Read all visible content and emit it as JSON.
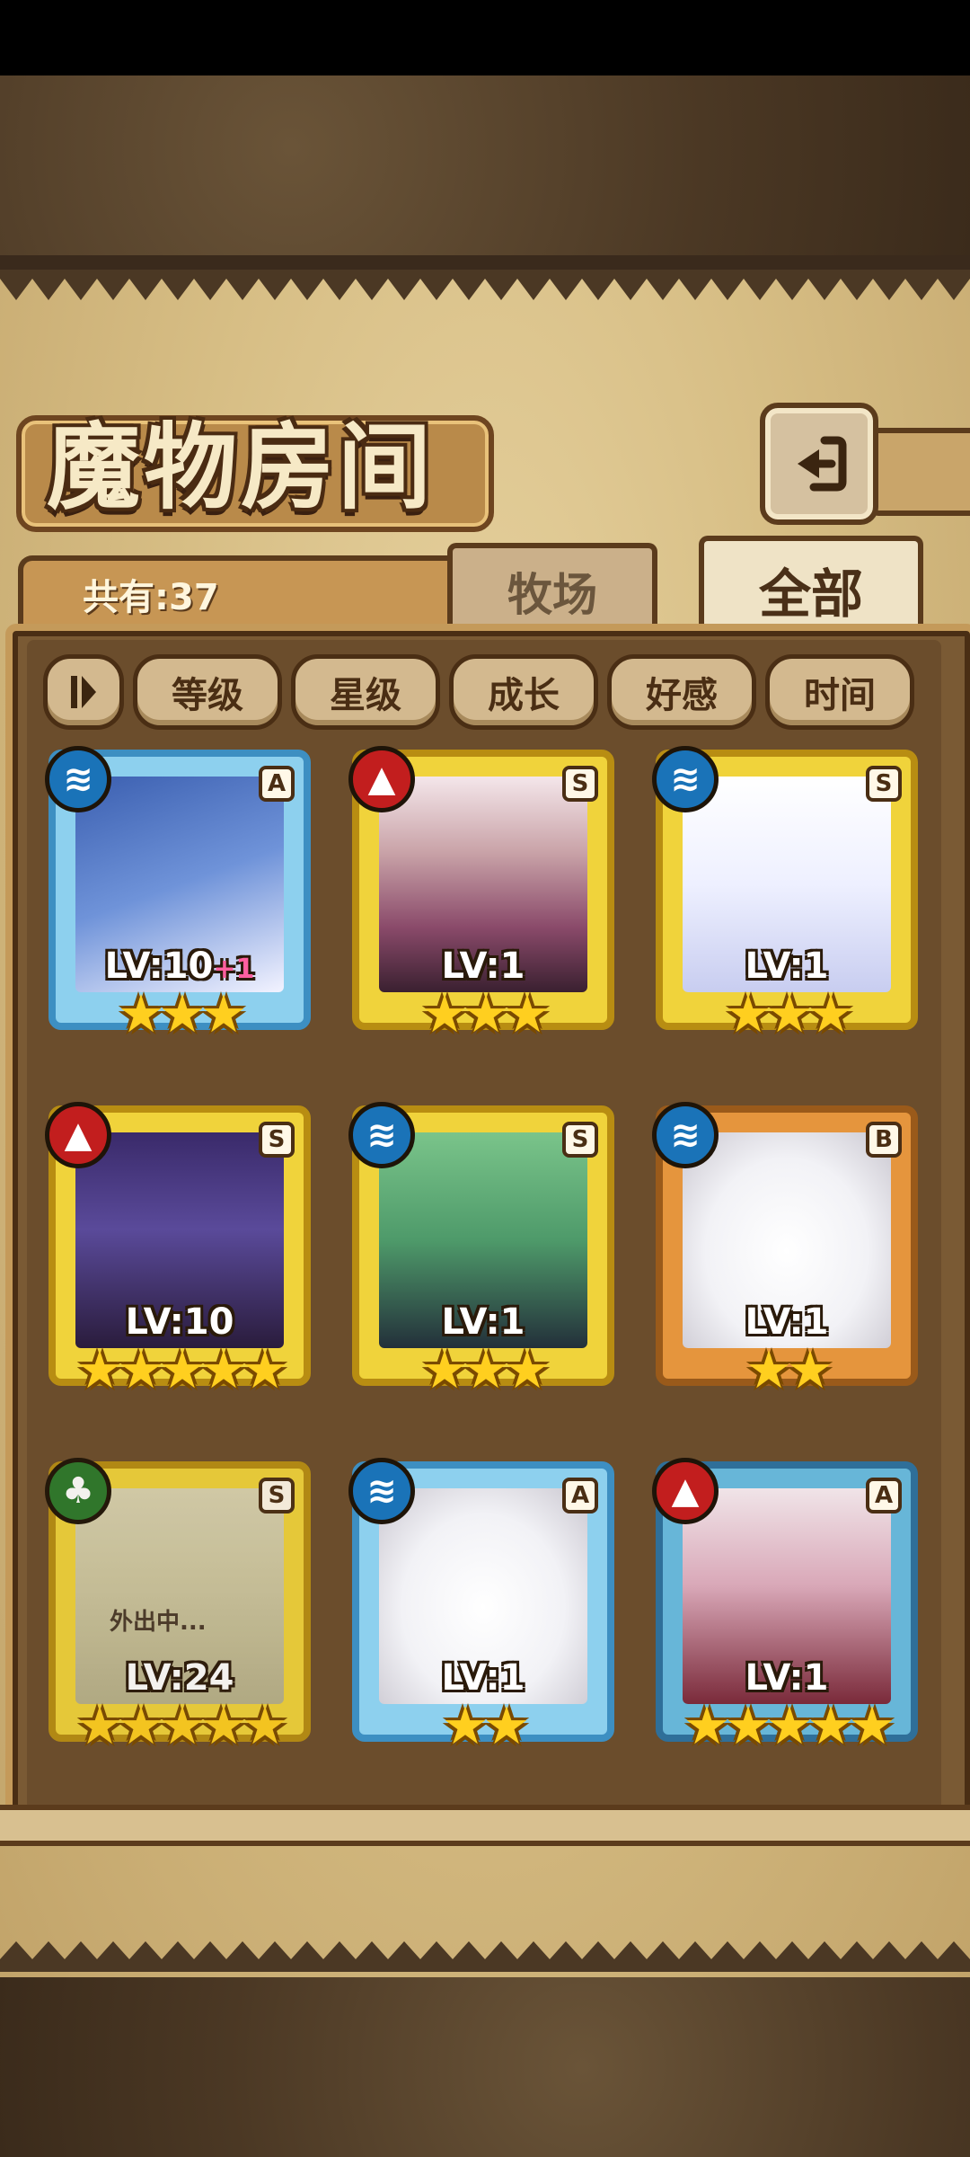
{
  "screen": {
    "title": "魔物房间",
    "count_label": "共有:37"
  },
  "tabs": [
    {
      "label": "牧场",
      "selected": false
    },
    {
      "label": "全部",
      "selected": true
    }
  ],
  "filters": [
    {
      "label": "等级"
    },
    {
      "label": "星级"
    },
    {
      "label": "成长"
    },
    {
      "label": "好感"
    },
    {
      "label": "时间"
    }
  ],
  "cards": [
    {
      "element": "water",
      "rank": "A",
      "level": "LV:10",
      "bonus": "+1",
      "stars": "★★★",
      "star_count": 3,
      "color": "#8dd0ee",
      "status": ""
    },
    {
      "element": "fire",
      "rank": "S",
      "level": "LV:1",
      "bonus": "",
      "stars": "★★★",
      "star_count": 3,
      "color": "#f0d33b",
      "status": ""
    },
    {
      "element": "water",
      "rank": "S",
      "level": "LV:1",
      "bonus": "",
      "stars": "★★★",
      "star_count": 3,
      "color": "#f0d33b",
      "status": ""
    },
    {
      "element": "fire",
      "rank": "S",
      "level": "LV:10",
      "bonus": "",
      "stars": "★★★★★",
      "star_count": 5,
      "color": "#f0d33b",
      "status": ""
    },
    {
      "element": "water",
      "rank": "S",
      "level": "LV:1",
      "bonus": "",
      "stars": "★★★",
      "star_count": 3,
      "color": "#f0d33b",
      "status": ""
    },
    {
      "element": "water",
      "rank": "B",
      "level": "LV:1",
      "bonus": "",
      "stars": "★★",
      "star_count": 2,
      "color": "#e5953d",
      "status": ""
    },
    {
      "element": "leaf",
      "rank": "S",
      "level": "LV:24",
      "bonus": "",
      "stars": "★★★★★",
      "star_count": 5,
      "color": "#f0d33b",
      "status": "外出中..."
    },
    {
      "element": "water",
      "rank": "A",
      "level": "LV:1",
      "bonus": "",
      "stars": "★★",
      "star_count": 2,
      "color": "#8dd0ee",
      "status": ""
    },
    {
      "element": "fire",
      "rank": "A",
      "level": "LV:1",
      "bonus": "",
      "stars": "★★★★★",
      "star_count": 5,
      "color": "#67b6d8",
      "status": ""
    }
  ],
  "icons": {
    "back": "back-arrow-icon",
    "filter_toggle": "sort-toggle-icon",
    "water": "water-element-icon",
    "fire": "fire-element-icon",
    "leaf": "leaf-element-icon"
  }
}
